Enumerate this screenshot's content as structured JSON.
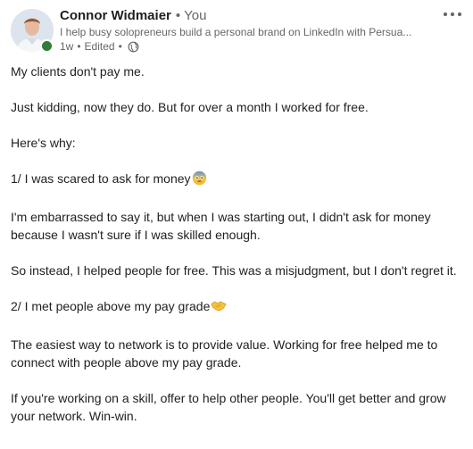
{
  "post": {
    "author_name": "Connor Widmaier",
    "separator": "•",
    "relation": "You",
    "headline": "I help busy solopreneurs build a personal brand on LinkedIn with Persua...",
    "time": "1w",
    "edited": "Edited",
    "more_icon": "three-dots-icon",
    "visibility_icon": "globe-icon",
    "accent_colors": {
      "presence": "#2e7d3b",
      "muted_text": "#666666"
    }
  },
  "content": {
    "p1": "My clients don't pay me.",
    "p2": "Just kidding, now they do. But for over a month I worked for free.",
    "p3": "Here's why:",
    "p4": "1/ I was scared to ask for money",
    "p4_emoji": "fearful-face-emoji",
    "p5": "I'm embarrassed to say it, but when I was starting out, I didn't ask for money because I wasn't sure if I was skilled enough.",
    "p6": "So instead, I helped people for free. This was a misjudgment, but I don't regret it.",
    "p7": "2/ I met people above my pay grade",
    "p7_emoji": "handshake-emoji",
    "p8": "The easiest way to network is to provide value. Working for free helped me to connect with people above my pay grade.",
    "p9": "If you're working on a skill, offer to help other people. You'll get better and grow your network. Win-win."
  }
}
